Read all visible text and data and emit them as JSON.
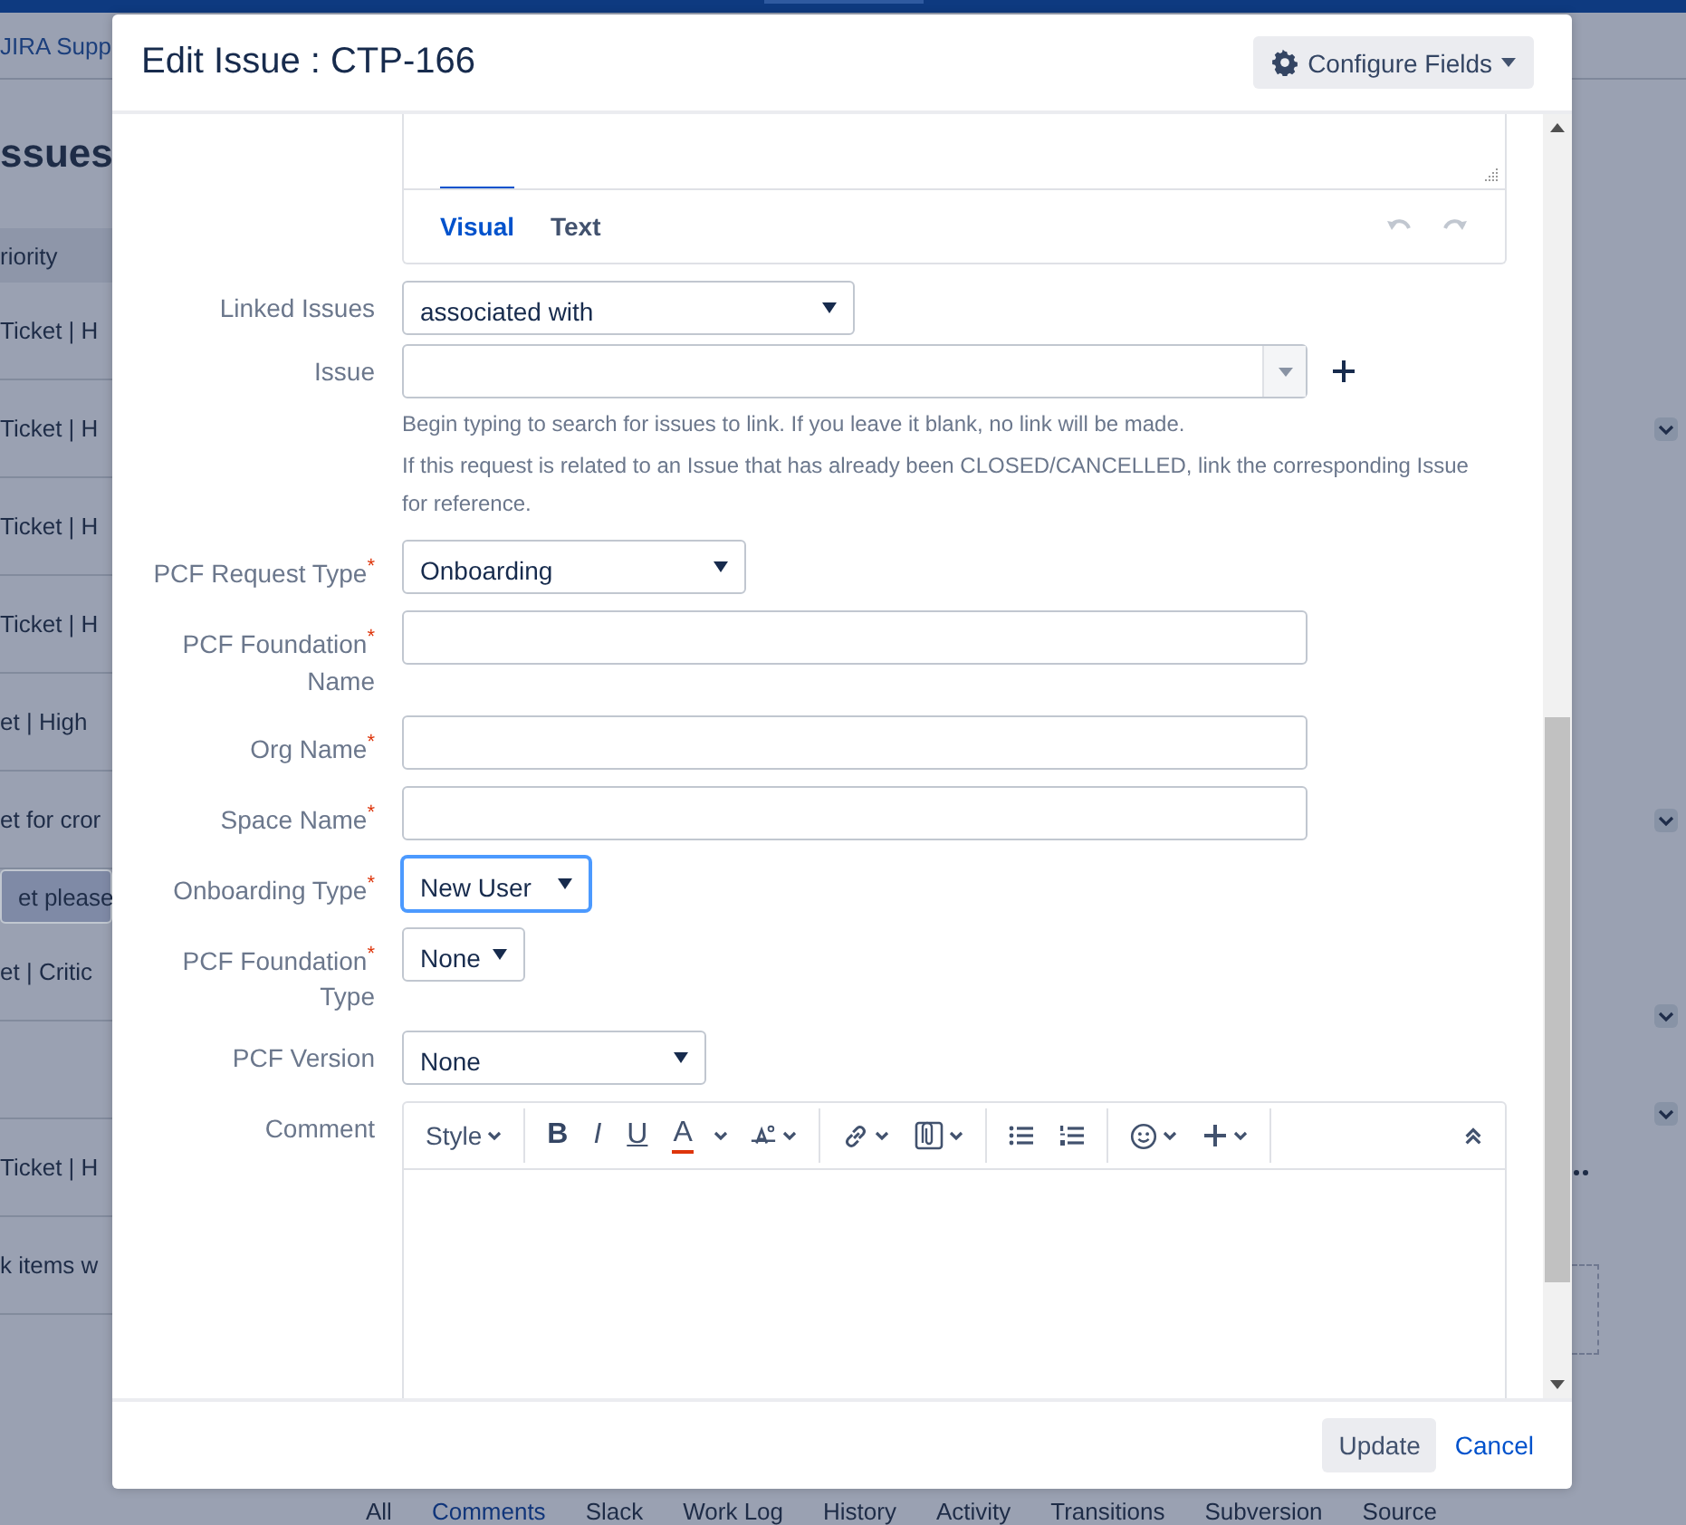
{
  "background": {
    "header_link": "JIRA Supp",
    "page_title": "ssues",
    "filter": "riority",
    "rows": [
      {
        "text": "Ticket | H",
        "selected": false
      },
      {
        "text": "Ticket | H",
        "selected": false
      },
      {
        "text": "Ticket | H",
        "selected": false
      },
      {
        "text": "Ticket | H",
        "selected": false
      },
      {
        "text": "et | High",
        "selected": false
      },
      {
        "text": "et for cror",
        "selected": false
      },
      {
        "text": "et please",
        "selected": true
      },
      {
        "text": "et | Critic",
        "selected": false
      },
      {
        "selected": false
      },
      {
        "text": "Ticket | H",
        "selected": false
      },
      {
        "text": "k items w",
        "selected": false
      }
    ],
    "tabs": [
      {
        "label": "All",
        "selected": false
      },
      {
        "label": "Comments",
        "selected": true
      },
      {
        "label": "Slack",
        "selected": false
      },
      {
        "label": "Work Log",
        "selected": false
      },
      {
        "label": "History",
        "selected": false
      },
      {
        "label": "Activity",
        "selected": false
      },
      {
        "label": "Transitions",
        "selected": false
      },
      {
        "label": "Subversion",
        "selected": false
      },
      {
        "label": "Source",
        "selected": false
      }
    ]
  },
  "dialog": {
    "title": "Edit Issue : CTP-166",
    "configure_button": "Configure Fields",
    "editor_tabs": [
      {
        "label": "Visual",
        "selected": true
      },
      {
        "label": "Text",
        "selected": false
      }
    ],
    "fields": [
      {
        "kind": "select",
        "label": "Linked Issues",
        "value": "associated with",
        "focused": false
      },
      {
        "kind": "combobox",
        "label": "Issue",
        "focused": false,
        "help": [
          "Begin typing to search for issues to link. If you leave it blank, no link will be made.",
          "If this request is related to an Issue that has already been CLOSED/CANCELLED, link the corresponding Issue for reference."
        ]
      },
      {
        "kind": "select",
        "label": "PCF Request Type$^{*}$",
        "value": "Onboarding",
        "focused": false
      },
      {
        "kind": "text",
        "label": "PCF Foundation$^{*}$ Name",
        "focused": false
      },
      {
        "kind": "text",
        "label": "Org Name$^{*}$",
        "focused": false
      },
      {
        "kind": "text",
        "label": "Space Name$^{*}$",
        "focused": false
      },
      {
        "kind": "select",
        "label": "Onboarding Type$^{*}$",
        "value": "New User",
        "focused": true
      },
      {
        "kind": "select",
        "label": "PCF Foundation$^{*}$ Type",
        "value": "None",
        "focused": false
      },
      {
        "kind": "select",
        "label": "PCF Version",
        "value": "None",
        "focused": false
      },
      {
        "kind": "editor",
        "label": "Comment",
        "focused": false
      }
    ],
    "toolbar": [
      {
        "items": [
          {
            "kind": "style",
            "label": "Style"
          }
        ]
      },
      {
        "items": [
          {
            "kind": "bold",
            "label": "B"
          },
          {
            "kind": "italic",
            "label": "I"
          },
          {
            "kind": "underline",
            "label": "U"
          },
          {
            "kind": "color",
            "label": "A"
          },
          {
            "kind": "format"
          }
        ]
      },
      {
        "items": [
          {
            "kind": "link"
          },
          {
            "kind": "attach"
          }
        ]
      },
      {
        "items": [
          {
            "kind": "bullets"
          },
          {
            "kind": "numbers"
          }
        ]
      },
      {
        "items": [
          {
            "kind": "emoji"
          },
          {
            "kind": "insert"
          }
        ]
      },
      {
        "items": [
          {
            "kind": "collapse"
          }
        ]
      }
    ],
    "update_button": "Update",
    "cancel_link": "Cancel"
  }
}
